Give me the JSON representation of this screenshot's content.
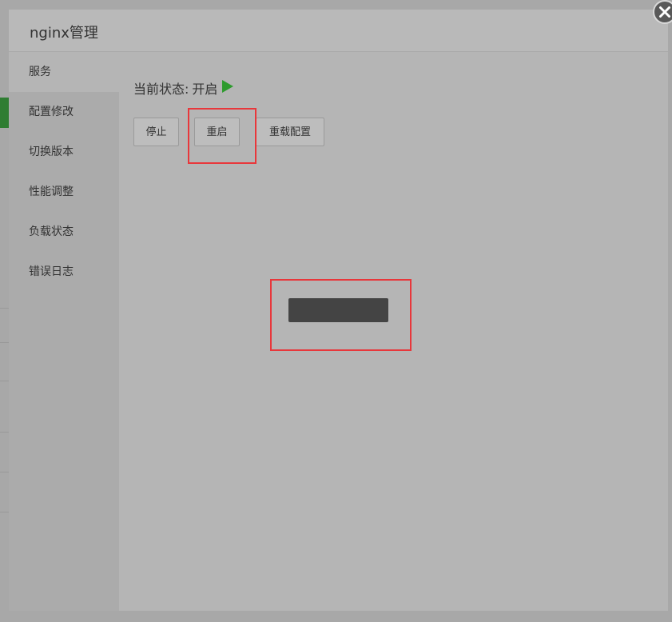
{
  "window": {
    "title": "nginx管理",
    "close_icon": "close-icon"
  },
  "sidebar": {
    "items": [
      {
        "label": "服务",
        "active": true
      },
      {
        "label": "配置修改",
        "active": false
      },
      {
        "label": "切换版本",
        "active": false
      },
      {
        "label": "性能调整",
        "active": false
      },
      {
        "label": "负载状态",
        "active": false
      },
      {
        "label": "错误日志",
        "active": false
      }
    ]
  },
  "service": {
    "status_label": "当前状态:",
    "status_value": "开启",
    "status_icon": "play-icon",
    "status_color": "#2e9b2e",
    "buttons": {
      "stop": "停止",
      "restart": "重启",
      "reload": "重载配置"
    }
  },
  "colors": {
    "highlight": "#e8373b",
    "loading": "#444444"
  }
}
